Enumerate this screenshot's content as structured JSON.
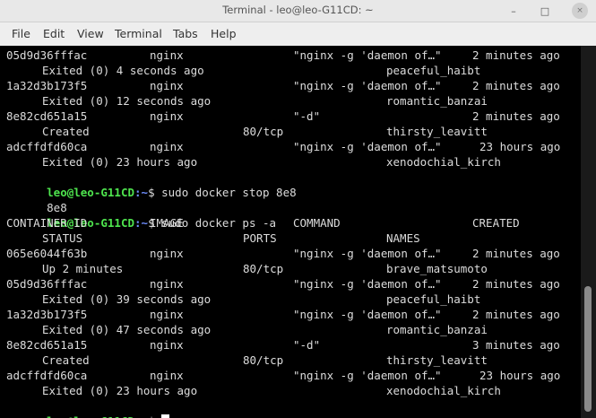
{
  "window": {
    "title": "Terminal - leo@leo-G11CD: ~",
    "controls": {
      "minimize": "–",
      "maximize": "□",
      "close": "×"
    }
  },
  "menu": [
    "File",
    "Edit",
    "View",
    "Terminal",
    "Tabs",
    "Help"
  ],
  "prompt": {
    "user": "leo@leo-G11CD",
    "path": ":~",
    "symbol": "$"
  },
  "commands": [
    "sudo docker stop 8e8",
    "sudo docker ps -a"
  ],
  "outputs": {
    "stop_result": "8e8"
  },
  "table_header": {
    "line1": [
      "CONTAINER ID",
      "IMAGE",
      "COMMAND",
      "CREATED"
    ],
    "line2": [
      "STATUS",
      "PORTS",
      "NAMES"
    ]
  },
  "first_listing": [
    {
      "id": "05d9d36fffac",
      "image": "nginx",
      "command": "\"nginx -g 'daemon of…\"",
      "created": "2 minutes ago",
      "status": "Exited (0) 4 seconds ago",
      "ports": "",
      "name": "peaceful_haibt"
    },
    {
      "id": "1a32d3b173f5",
      "image": "nginx",
      "command": "\"nginx -g 'daemon of…\"",
      "created": "2 minutes ago",
      "status": "Exited (0) 12 seconds ago",
      "ports": "",
      "name": "romantic_banzai"
    },
    {
      "id": "8e82cd651a15",
      "image": "nginx",
      "command": "\"-d\"",
      "created": "2 minutes ago",
      "status": "Created",
      "ports": "80/tcp",
      "name": "thirsty_leavitt"
    },
    {
      "id": "adcffdfd60ca",
      "image": "nginx",
      "command": "\"nginx -g 'daemon of…\"",
      "created": "23 hours ago",
      "status": "Exited (0) 23 hours ago",
      "ports": "",
      "name": "xenodochial_kirch"
    }
  ],
  "second_listing": [
    {
      "id": "065e6044f63b",
      "image": "nginx",
      "command": "\"nginx -g 'daemon of…\"",
      "created": "2 minutes ago",
      "status": "Up 2 minutes",
      "ports": "80/tcp",
      "name": "brave_matsumoto"
    },
    {
      "id": "05d9d36fffac",
      "image": "nginx",
      "command": "\"nginx -g 'daemon of…\"",
      "created": "2 minutes ago",
      "status": "Exited (0) 39 seconds ago",
      "ports": "",
      "name": "peaceful_haibt"
    },
    {
      "id": "1a32d3b173f5",
      "image": "nginx",
      "command": "\"nginx -g 'daemon of…\"",
      "created": "2 minutes ago",
      "status": "Exited (0) 47 seconds ago",
      "ports": "",
      "name": "romantic_banzai"
    },
    {
      "id": "8e82cd651a15",
      "image": "nginx",
      "command": "\"-d\"",
      "created": "3 minutes ago",
      "status": "Created",
      "ports": "80/tcp",
      "name": "thirsty_leavitt"
    },
    {
      "id": "adcffdfd60ca",
      "image": "nginx",
      "command": "\"nginx -g 'daemon of…\"",
      "created": "23 hours ago",
      "status": "Exited (0) 23 hours ago",
      "ports": "",
      "name": "xenodochial_kirch"
    }
  ]
}
